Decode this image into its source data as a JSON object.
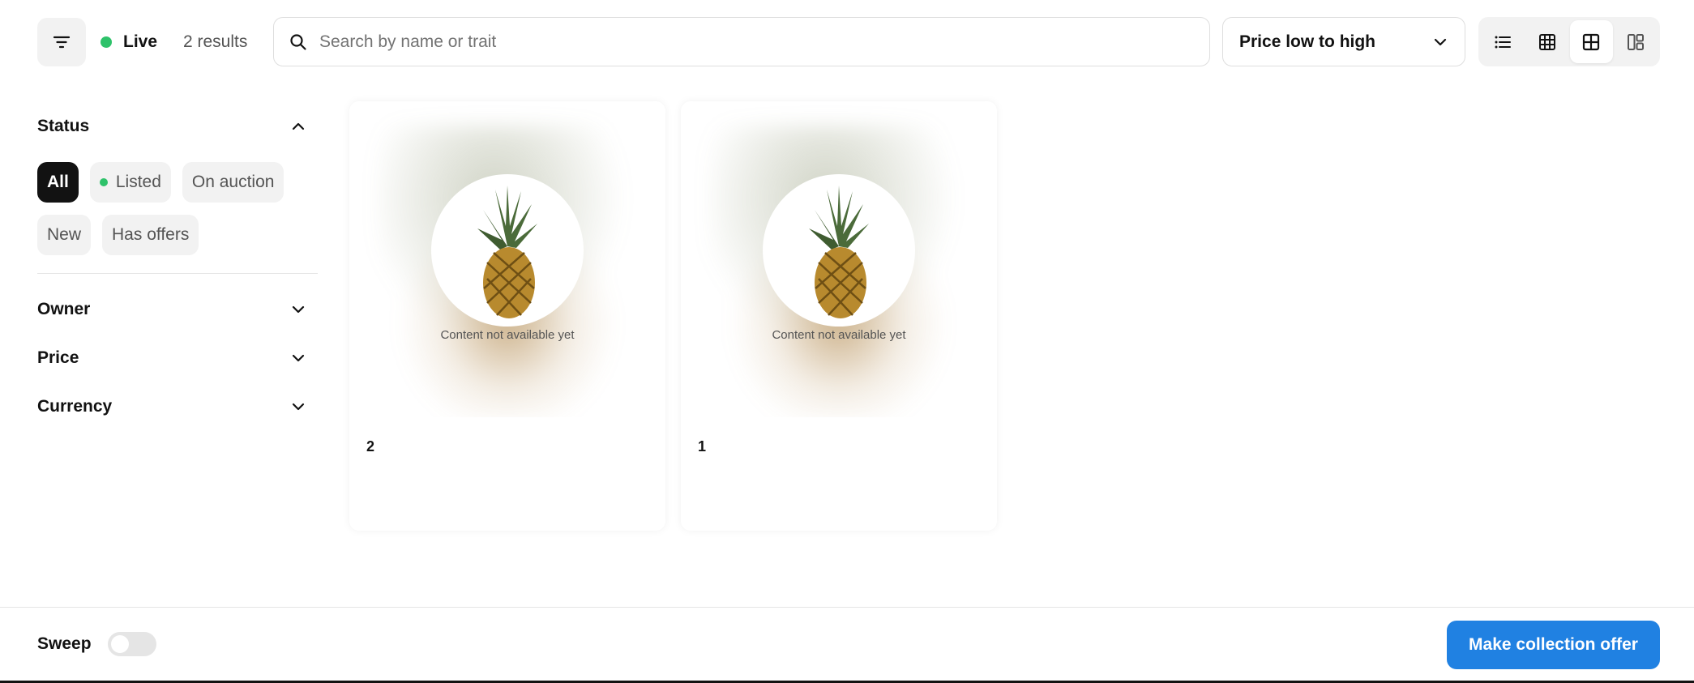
{
  "toolbar": {
    "live_label": "Live",
    "live_color": "#2ec26a",
    "results_text": "2 results",
    "search_placeholder": "Search by name or trait",
    "search_value": "",
    "sort_selected": "Price low to high",
    "view_modes": [
      "list-icon",
      "grid-small-icon",
      "grid-medium-icon",
      "grid-large-icon"
    ],
    "active_view": "grid-medium-icon"
  },
  "sidebar": {
    "status": {
      "title": "Status",
      "chips": [
        {
          "label": "All",
          "selected": true
        },
        {
          "label": "Listed",
          "selected": false,
          "dot": true
        },
        {
          "label": "On auction",
          "selected": false
        },
        {
          "label": "New",
          "selected": false
        },
        {
          "label": "Has offers",
          "selected": false
        }
      ]
    },
    "sections": [
      {
        "title": "Owner"
      },
      {
        "title": "Price"
      },
      {
        "title": "Currency"
      }
    ]
  },
  "items": [
    {
      "name": "2",
      "media_status": "Content not available yet",
      "image": "pineapple"
    },
    {
      "name": "1",
      "media_status": "Content not available yet",
      "image": "pineapple"
    }
  ],
  "footer": {
    "sweep_label": "Sweep",
    "sweep_on": false,
    "offer_button": "Make collection offer",
    "accent_color": "#2081e2"
  }
}
